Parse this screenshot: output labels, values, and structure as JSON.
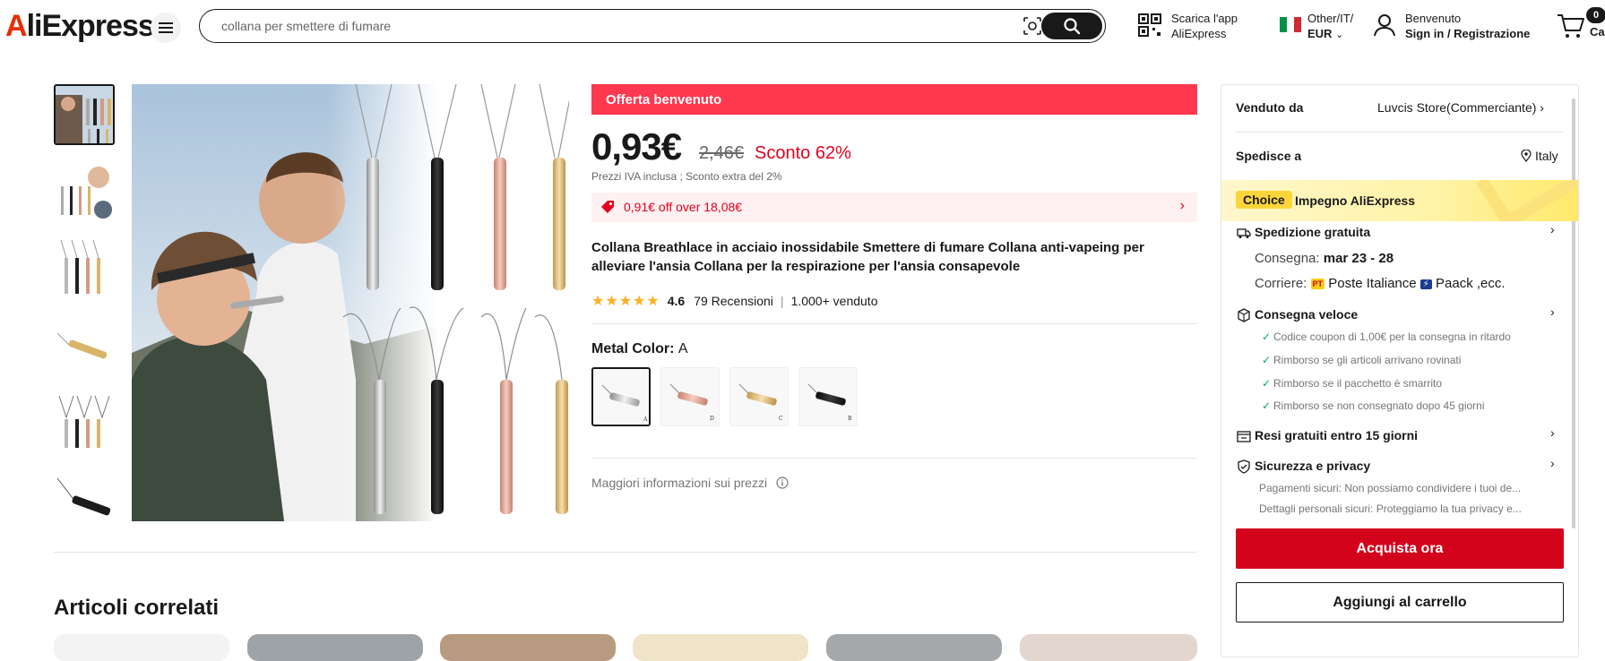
{
  "header": {
    "logo": "AliExpress",
    "search_value": "collana per smettere di fumare",
    "app_line1": "Scarica l'app",
    "app_line2": "AliExpress",
    "locale_line1": "Other/IT/",
    "locale_line2": "EUR",
    "welcome": "Benvenuto",
    "signin": "Sign in / Registrazione",
    "cart_count": "0",
    "cart_label": "Ca"
  },
  "product": {
    "offer_banner": "Offerta benvenuto",
    "price": "0,93€",
    "old_price": "2,46€",
    "discount": "Sconto 62%",
    "tax_note": "Prezzi IVA inclusa ; Sconto extra del 2%",
    "coupon": "0,91€ off over 18,08€",
    "title": "Collana Breathlace in acciaio inossidabile Smettere di fumare Collana anti-vapeing per alleviare l'ansia Collana per la respirazione per l'ansia consapevole",
    "rating_score": "4.6",
    "reviews": "79 Recensioni",
    "sold": "1.000+ venduto",
    "rating_value": 4.6,
    "metal_label": "Metal Color:",
    "metal_value": "A",
    "variants": [
      "A",
      "D",
      "C",
      "B"
    ],
    "more_info": "Maggiori informazioni sui prezzi"
  },
  "related": {
    "title": "Articoli correlati"
  },
  "panel": {
    "sold_by_label": "Venduto da",
    "store": "Luvcis Store(Commerciante)",
    "ship_to_label": "Spedisce a",
    "ship_to": "Italy",
    "choice_tag": "Choice",
    "choice_label": "Impegno AliExpress",
    "free_shipping": "Spedizione gratuita",
    "delivery_label": "Consegna:",
    "delivery_dates": "mar 23 - 28",
    "courier_label": "Corriere:",
    "courier_pt": "PT",
    "courier1": "Poste Italiance",
    "courier2": "Paack ,ecc.",
    "fast_delivery": "Consegna veloce",
    "checks": [
      "Codice coupon di 1,00€ per la consegna in ritardo",
      "Rimborso se gli articoli arrivano rovinati",
      "Rimborso se il pacchetto è smarrito",
      "Rimborso se non consegnato dopo 45 giorni"
    ],
    "returns": "Resi gratuiti entro 15 giorni",
    "security": "Sicurezza e privacy",
    "secure_pay": "Pagamenti sicuri: Non possiamo condividere i tuoi de...",
    "secure_data": "Dettagli personali sicuri: Proteggiamo la tua privacy e...",
    "buy_now": "Acquista ora",
    "add_to_cart": "Aggiungi al carrello"
  },
  "colors": {
    "brand_red": "#e62e04",
    "offer_red": "#fd384f",
    "buy_red": "#d3031c",
    "star": "#fdb022",
    "choice_yellow": "#fbd53a"
  }
}
